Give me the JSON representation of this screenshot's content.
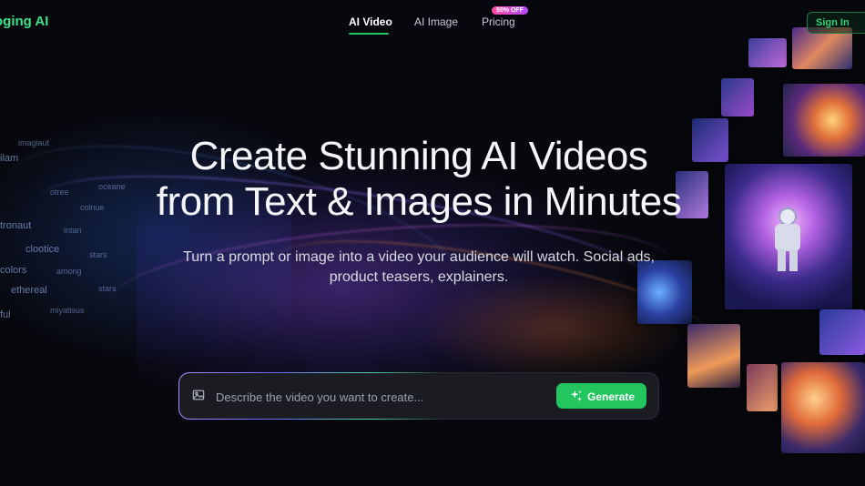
{
  "header": {
    "logo_text": "oging AI",
    "nav": [
      {
        "label": "AI Video",
        "active": true
      },
      {
        "label": "AI Image",
        "active": false
      },
      {
        "label": "Pricing",
        "active": false
      }
    ],
    "pricing_badge": "50% OFF",
    "signin_label": "Sign In"
  },
  "hero": {
    "title_line1": "Create Stunning AI Videos",
    "title_line2": "from Text & Images in Minutes",
    "subtitle_line1": "Turn a prompt or image into a video your audience will watch. Social ads,",
    "subtitle_line2": "product teasers, explainers."
  },
  "prompt": {
    "placeholder": "Describe the video you want to create...",
    "value": "",
    "generate_label": "Generate"
  },
  "background_words": [
    "imagiaut",
    "ilam",
    "otree",
    "oceane",
    "colnue",
    "tronaut",
    "intan",
    "clootice",
    "stars",
    "colors",
    "among",
    "ethereal",
    "stars",
    "ful",
    "miyatisus"
  ],
  "colors": {
    "accent": "#22c55e",
    "logo": "#3ee089",
    "background": "#07080d",
    "badge_start": "#ff4ea0",
    "badge_end": "#b04cff"
  }
}
